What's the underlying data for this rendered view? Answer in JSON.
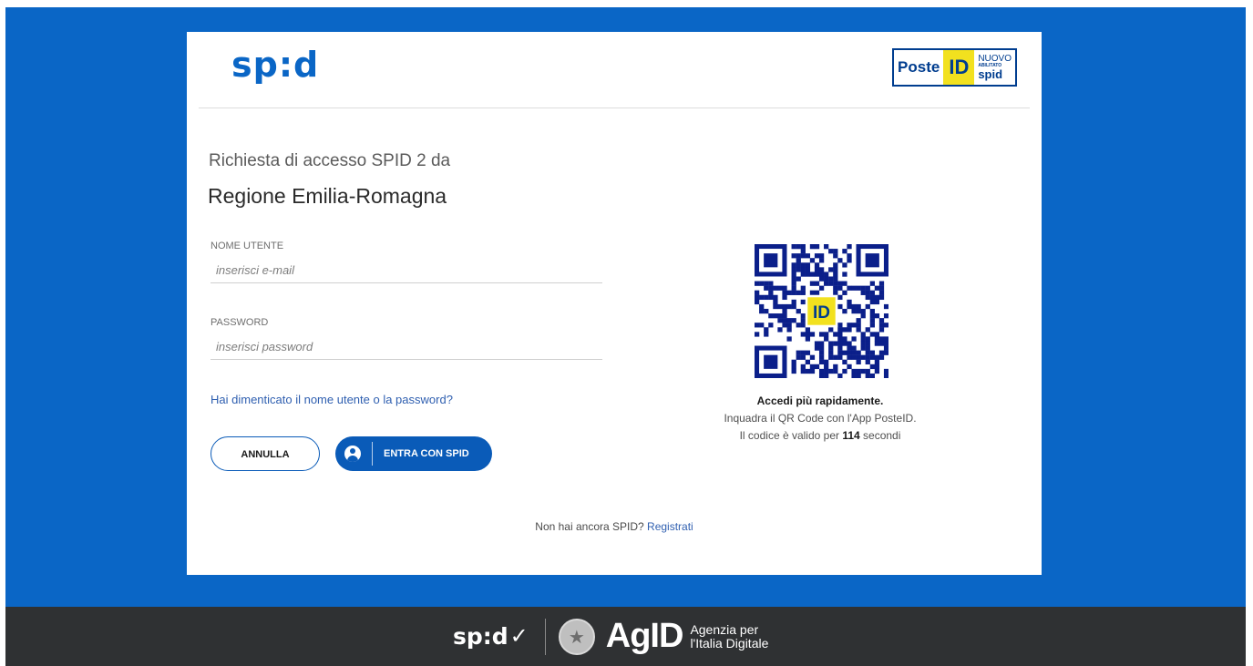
{
  "header": {
    "logo_text": "sp:d",
    "poste_logo": {
      "poste": "Poste",
      "id": "ID",
      "nuovo": "NUOVO",
      "abilitato": "ABILITATO",
      "spid": "spid"
    }
  },
  "request": {
    "title": "Richiesta di accesso SPID 2 da",
    "entity": "Regione Emilia-Romagna"
  },
  "form": {
    "username": {
      "label": "NOME UTENTE",
      "placeholder": "inserisci e-mail",
      "value": ""
    },
    "password": {
      "label": "PASSWORD",
      "placeholder": "inserisci password",
      "value": ""
    },
    "forgot_link": "Hai dimenticato il nome utente o la password?",
    "cancel_label": "ANNULLA",
    "enter_label": "ENTRA CON SPID",
    "enter_icon": "user-circle-icon"
  },
  "qr": {
    "center_label": "ID",
    "headline": "Accedi più rapidamente.",
    "line2": "Inquadra il QR Code con l'App PosteID.",
    "line3_prefix": "Il codice è valido per ",
    "seconds": "114",
    "line3_suffix": " secondi"
  },
  "register": {
    "prefix": "Non hai ancora SPID?",
    "link": "Registrati"
  },
  "footer": {
    "spid": "sp:d",
    "check": "✓",
    "agid": "AgID",
    "agency_line1": "Agenzia per",
    "agency_line2": "l'Italia Digitale"
  },
  "colors": {
    "brand_blue": "#0a66c6",
    "button_blue": "#0a5bb8",
    "poste_yellow": "#f2e11f",
    "footer_bg": "#2f3133"
  }
}
